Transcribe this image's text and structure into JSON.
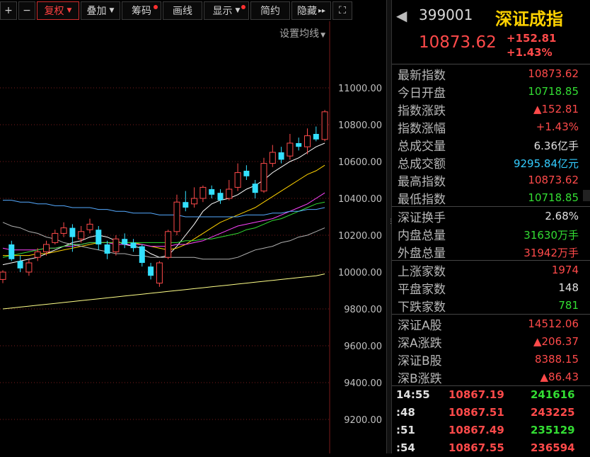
{
  "toolbar": {
    "plus": "+",
    "minus": "−",
    "fuquan": "复权",
    "diejia": "叠加",
    "chouma": "筹码",
    "huaxian": "画线",
    "xianshi": "显示",
    "jianyue": "简约",
    "yincang": "隐藏",
    "more": "▸▸",
    "fullscreen": "⛶"
  },
  "ma_setting": "设置均线",
  "y_axis": [
    "11000.00",
    "10800.00",
    "10600.00",
    "10400.00",
    "10200.00",
    "10000.00",
    "9800.00",
    "9600.00",
    "9400.00",
    "9200.00"
  ],
  "colors": {
    "up": "#ff4a4a",
    "down": "#33e0ff",
    "ma5": "#ffffff",
    "ma10": "#ffd200",
    "ma20": "#ff44ff",
    "ma30": "#33dd33",
    "ma60": "#b0b0b0",
    "ma120": "#55aaff",
    "ma250": "#ffff88"
  },
  "chart_data": {
    "type": "candlestick",
    "ylim": [
      9100,
      11200
    ],
    "candles": [
      {
        "o": 9960,
        "c": 10000,
        "h": 10010,
        "l": 9940
      },
      {
        "o": 10150,
        "c": 10070,
        "h": 10170,
        "l": 10060
      },
      {
        "o": 10060,
        "c": 10020,
        "h": 10090,
        "l": 10000
      },
      {
        "o": 10000,
        "c": 10050,
        "h": 10070,
        "l": 9980
      },
      {
        "o": 10080,
        "c": 10110,
        "h": 10130,
        "l": 10060
      },
      {
        "o": 10110,
        "c": 10150,
        "h": 10170,
        "l": 10090
      },
      {
        "o": 10160,
        "c": 10210,
        "h": 10230,
        "l": 10150
      },
      {
        "o": 10210,
        "c": 10240,
        "h": 10270,
        "l": 10190
      },
      {
        "o": 10240,
        "c": 10190,
        "h": 10260,
        "l": 10110
      },
      {
        "o": 10180,
        "c": 10220,
        "h": 10250,
        "l": 10160
      },
      {
        "o": 10230,
        "c": 10260,
        "h": 10290,
        "l": 10210
      },
      {
        "o": 10230,
        "c": 10150,
        "h": 10250,
        "l": 10120
      },
      {
        "o": 10150,
        "c": 10100,
        "h": 10170,
        "l": 10070
      },
      {
        "o": 10110,
        "c": 10180,
        "h": 10200,
        "l": 10090
      },
      {
        "o": 10180,
        "c": 10150,
        "h": 10210,
        "l": 10130
      },
      {
        "o": 10160,
        "c": 10130,
        "h": 10180,
        "l": 10110
      },
      {
        "o": 10140,
        "c": 10050,
        "h": 10150,
        "l": 10030
      },
      {
        "o": 10030,
        "c": 9980,
        "h": 10050,
        "l": 9960
      },
      {
        "o": 9940,
        "c": 10050,
        "h": 10060,
        "l": 9920
      },
      {
        "o": 10080,
        "c": 10220,
        "h": 10230,
        "l": 10070
      },
      {
        "o": 10220,
        "c": 10380,
        "h": 10420,
        "l": 10200
      },
      {
        "o": 10380,
        "c": 10350,
        "h": 10440,
        "l": 10330
      },
      {
        "o": 10370,
        "c": 10400,
        "h": 10460,
        "l": 10350
      },
      {
        "o": 10400,
        "c": 10460,
        "h": 10470,
        "l": 10380
      },
      {
        "o": 10450,
        "c": 10420,
        "h": 10470,
        "l": 10400
      },
      {
        "o": 10430,
        "c": 10390,
        "h": 10450,
        "l": 10370
      },
      {
        "o": 10400,
        "c": 10450,
        "h": 10500,
        "l": 10390
      },
      {
        "o": 10460,
        "c": 10540,
        "h": 10590,
        "l": 10440
      },
      {
        "o": 10550,
        "c": 10520,
        "h": 10580,
        "l": 10500
      },
      {
        "o": 10480,
        "c": 10430,
        "h": 10500,
        "l": 10400
      },
      {
        "o": 10440,
        "c": 10590,
        "h": 10620,
        "l": 10430
      },
      {
        "o": 10590,
        "c": 10650,
        "h": 10690,
        "l": 10570
      },
      {
        "o": 10650,
        "c": 10610,
        "h": 10680,
        "l": 10590
      },
      {
        "o": 10630,
        "c": 10700,
        "h": 10750,
        "l": 10610
      },
      {
        "o": 10700,
        "c": 10680,
        "h": 10730,
        "l": 10660
      },
      {
        "o": 10680,
        "c": 10740,
        "h": 10780,
        "l": 10640
      },
      {
        "o": 10750,
        "c": 10720,
        "h": 10790,
        "l": 10710
      },
      {
        "o": 10720,
        "c": 10870,
        "h": 10880,
        "l": 10710
      }
    ],
    "ma_lines": [
      {
        "name": "ma5",
        "values": [
          10040,
          10050,
          10060,
          10070,
          10080,
          10100,
          10120,
          10140,
          10160,
          10170,
          10190,
          10200,
          10190,
          10170,
          10150,
          10140,
          10130,
          10100,
          10080,
          10090,
          10140,
          10200,
          10260,
          10330,
          10370,
          10390,
          10400,
          10420,
          10450,
          10470,
          10500,
          10540,
          10570,
          10600,
          10620,
          10650,
          10680,
          10700
        ]
      },
      {
        "name": "ma10",
        "values": [
          10090,
          10090,
          10090,
          10090,
          10100,
          10100,
          10110,
          10120,
          10130,
          10140,
          10150,
          10160,
          10160,
          10160,
          10160,
          10160,
          10150,
          10140,
          10130,
          10120,
          10130,
          10150,
          10180,
          10210,
          10240,
          10270,
          10290,
          10310,
          10330,
          10350,
          10380,
          10410,
          10440,
          10470,
          10500,
          10530,
          10550,
          10580
        ]
      },
      {
        "name": "ma20",
        "values": [
          10130,
          10120,
          10120,
          10120,
          10120,
          10130,
          10130,
          10140,
          10140,
          10150,
          10160,
          10160,
          10160,
          10150,
          10150,
          10150,
          10150,
          10140,
          10140,
          10140,
          10150,
          10150,
          10160,
          10170,
          10190,
          10210,
          10230,
          10250,
          10260,
          10270,
          10280,
          10290,
          10310,
          10330,
          10350,
          10370,
          10400,
          10430
        ]
      },
      {
        "name": "ma30",
        "values": [
          10080,
          10090,
          10100,
          10110,
          10120,
          10130,
          10130,
          10140,
          10150,
          10150,
          10160,
          10160,
          10160,
          10160,
          10160,
          10160,
          10160,
          10160,
          10160,
          10160,
          10160,
          10170,
          10170,
          10180,
          10180,
          10190,
          10200,
          10210,
          10230,
          10240,
          10260,
          10280,
          10290,
          10310,
          10330,
          10350,
          10370,
          10380
        ]
      },
      {
        "name": "ma60",
        "values": [
          10270,
          10250,
          10240,
          10220,
          10210,
          10190,
          10180,
          10160,
          10150,
          10140,
          10130,
          10120,
          10110,
          10100,
          10100,
          10090,
          10090,
          10080,
          10080,
          10080,
          10080,
          10080,
          10080,
          10070,
          10070,
          10070,
          10070,
          10080,
          10100,
          10120,
          10130,
          10140,
          10160,
          10170,
          10190,
          10200,
          10220,
          10240
        ]
      },
      {
        "name": "ma120",
        "values": [
          10390,
          10390,
          10380,
          10380,
          10370,
          10370,
          10360,
          10360,
          10350,
          10350,
          10350,
          10340,
          10340,
          10330,
          10330,
          10320,
          10320,
          10320,
          10310,
          10310,
          10310,
          10300,
          10300,
          10300,
          10300,
          10300,
          10300,
          10300,
          10310,
          10310,
          10310,
          10320,
          10320,
          10330,
          10330,
          10340,
          10340,
          10350
        ]
      },
      {
        "name": "ma250",
        "values": [
          9800,
          9805,
          9810,
          9815,
          9820,
          9825,
          9830,
          9835,
          9840,
          9845,
          9850,
          9855,
          9860,
          9865,
          9870,
          9875,
          9880,
          9885,
          9890,
          9895,
          9900,
          9905,
          9910,
          9915,
          9920,
          9925,
          9930,
          9935,
          9940,
          9945,
          9950,
          9955,
          9960,
          9965,
          9970,
          9975,
          9980,
          9990
        ]
      }
    ]
  },
  "header": {
    "arrow": "◀",
    "code": "399001",
    "name": "深证成指",
    "price": "10873.62",
    "change": "+152.81",
    "pct": "+1.43%"
  },
  "quote1": [
    {
      "label": "最新指数",
      "value": "10873.62",
      "color": "red"
    },
    {
      "label": "今日开盘",
      "value": "10718.85",
      "color": "green"
    },
    {
      "label": "指数涨跌",
      "value": "▲152.81",
      "color": "red"
    },
    {
      "label": "指数涨幅",
      "value": "+1.43%",
      "color": "red"
    },
    {
      "label": "总成交量",
      "value": "6.36亿手",
      "color": "white"
    },
    {
      "label": "总成交额",
      "value": "9295.84亿元",
      "color": "cyan"
    },
    {
      "label": "最高指数",
      "value": "10873.62",
      "color": "red"
    },
    {
      "label": "最低指数",
      "value": "10718.85",
      "color": "green"
    }
  ],
  "quote2": [
    {
      "label": "深证换手",
      "value": "2.68%",
      "color": "white"
    },
    {
      "label": "内盘总量",
      "value": "31630万手",
      "color": "green"
    },
    {
      "label": "外盘总量",
      "value": "31942万手",
      "color": "red"
    }
  ],
  "quote3": [
    {
      "label": "上涨家数",
      "value": "1974",
      "color": "red"
    },
    {
      "label": "平盘家数",
      "value": "148",
      "color": "white"
    },
    {
      "label": "下跌家数",
      "value": "781",
      "color": "green"
    }
  ],
  "quote4": [
    {
      "label": "深证A股",
      "value": "14512.06",
      "color": "red"
    },
    {
      "label": "深A涨跌",
      "value": "▲206.37",
      "color": "red"
    },
    {
      "label": "深证B股",
      "value": "8388.15",
      "color": "red"
    },
    {
      "label": "深B涨跌",
      "value": "▲86.43",
      "color": "red"
    }
  ],
  "ticks": [
    {
      "time": "14:55",
      "price": "10867.19",
      "vol": "241616",
      "vcolor": "green"
    },
    {
      "time": ":48",
      "price": "10867.51",
      "vol": "243225",
      "vcolor": "red"
    },
    {
      "time": ":51",
      "price": "10867.49",
      "vol": "235129",
      "vcolor": "green"
    },
    {
      "time": ":54",
      "price": "10867.55",
      "vol": "236594",
      "vcolor": "red"
    }
  ]
}
